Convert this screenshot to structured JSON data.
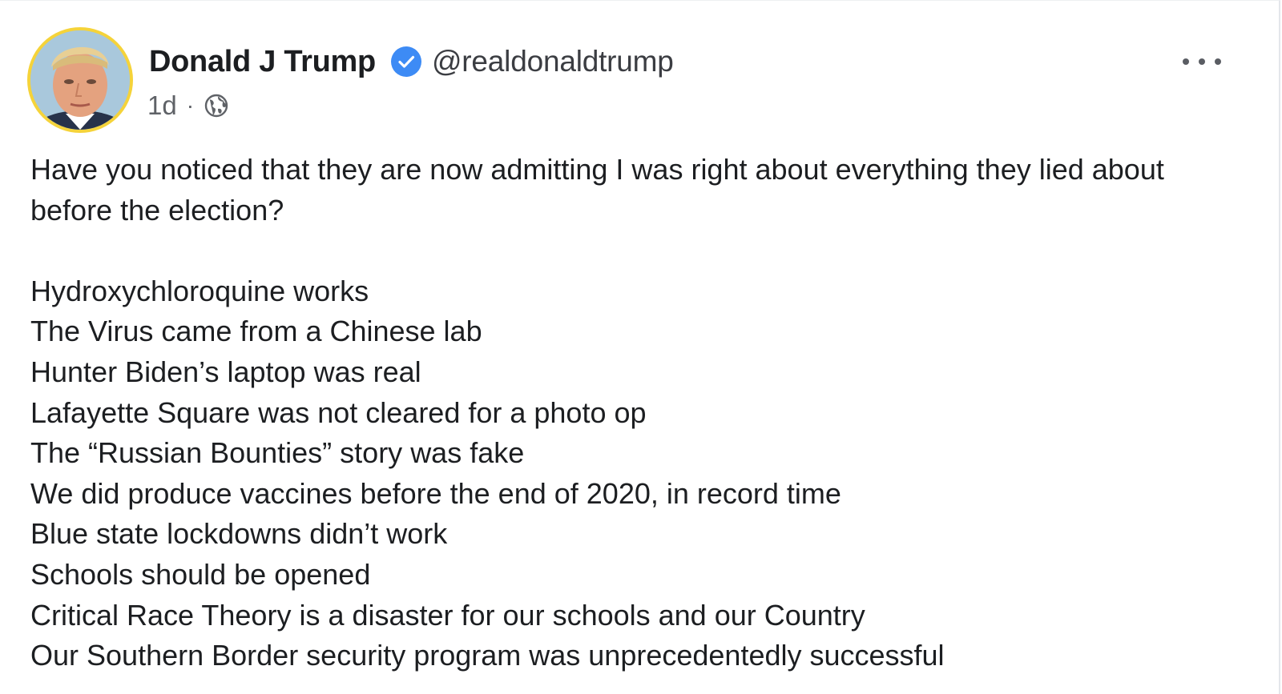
{
  "post": {
    "author_name": "Donald J Trump",
    "handle": "@realdonaldtrump",
    "time": "1d",
    "separator": "·",
    "verified_icon": "verified-badge-icon",
    "audience_icon": "globe-icon",
    "more_icon": "more-options-icon",
    "intro": "Have you noticed that they are now admitting I was right about everything they lied about before the election?",
    "claims": [
      "Hydroxychloroquine works",
      "The Virus came from a Chinese lab",
      "Hunter Biden’s laptop was real",
      "Lafayette Square was not cleared for a photo op",
      "The “Russian Bounties” story was fake",
      "We did produce vaccines before the end of 2020, in record time",
      "Blue state lockdowns didn’t work",
      "Schools should be opened",
      "Critical Race Theory is a disaster for our schools and our Country",
      "Our Southern Border security program was unprecedentedly successful"
    ]
  },
  "colors": {
    "avatar_ring": "#f5d33a",
    "verified_blue": "#3d8bf5",
    "text_primary": "#1c1e21",
    "text_secondary": "#5f6267"
  }
}
